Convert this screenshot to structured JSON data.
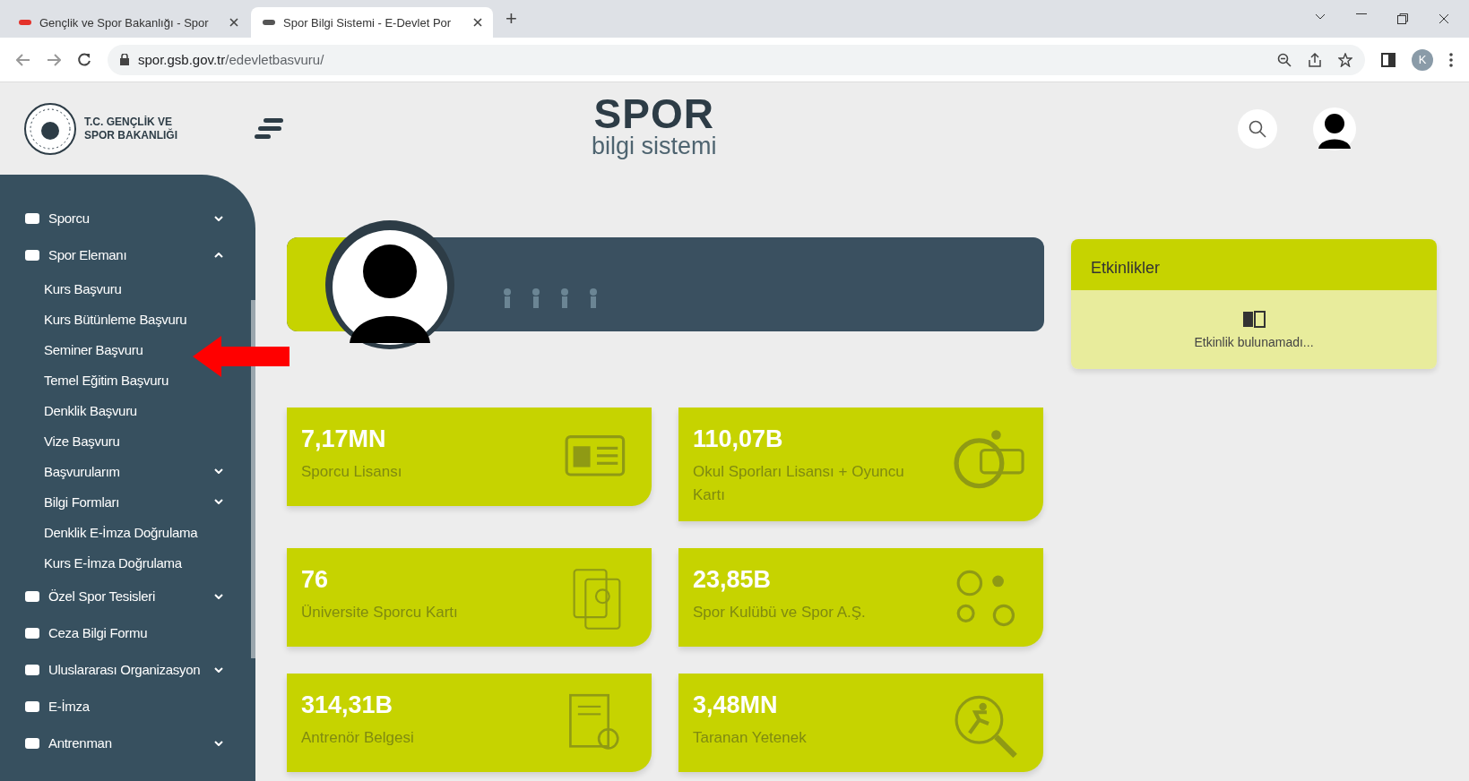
{
  "browser": {
    "tabs": [
      {
        "title": "Gençlik ve Spor Bakanlığı - Spor",
        "selected": false
      },
      {
        "title": "Spor Bilgi Sistemi - E-Devlet Por",
        "selected": true
      }
    ],
    "new_tab": "+",
    "address": {
      "host": "spor.gsb.gov.tr",
      "path": "/edevletbasvuru/"
    },
    "profile_initial": "K"
  },
  "header": {
    "ministry": "T.C. GENÇLİK VE SPOR BAKANLIĞI",
    "logo_title": "SPOR",
    "logo_subtitle": "bilgi sistemi"
  },
  "sidebar": {
    "items": [
      {
        "label": "Sporcu",
        "kind": "group",
        "expanded": false
      },
      {
        "label": "Spor Elemanı",
        "kind": "group",
        "expanded": true,
        "children": [
          {
            "label": "Kurs Başvuru",
            "kind": "link"
          },
          {
            "label": "Kurs Bütünleme Başvuru",
            "kind": "link"
          },
          {
            "label": "Seminer Başvuru",
            "kind": "link"
          },
          {
            "label": "Temel Eğitim Başvuru",
            "kind": "link"
          },
          {
            "label": "Denklik Başvuru",
            "kind": "link"
          },
          {
            "label": "Vize Başvuru",
            "kind": "link"
          },
          {
            "label": "Başvurularım",
            "kind": "group",
            "expanded": false
          },
          {
            "label": "Bilgi Formları",
            "kind": "group",
            "expanded": false
          },
          {
            "label": "Denklik E-İmza Doğrulama",
            "kind": "link"
          },
          {
            "label": "Kurs E-İmza Doğrulama",
            "kind": "link"
          }
        ]
      },
      {
        "label": "Özel Spor Tesisleri",
        "kind": "group",
        "expanded": false
      },
      {
        "label": "Ceza Bilgi Formu",
        "kind": "link"
      },
      {
        "label": "Uluslararası Organizasyon",
        "kind": "group",
        "expanded": false
      },
      {
        "label": "E-İmza",
        "kind": "link"
      },
      {
        "label": "Antrenman",
        "kind": "group",
        "expanded": false
      }
    ]
  },
  "stats": [
    {
      "value": "7,17MN",
      "label": "Sporcu Lisansı",
      "kind": "license"
    },
    {
      "value": "110,07B",
      "label": "Okul Sporları Lisansı + Oyuncu Kartı",
      "kind": "school"
    },
    {
      "value": "76",
      "label": "Üniversite Sporcu Kartı",
      "kind": "university"
    },
    {
      "value": "23,85B",
      "label": "Spor Kulübü ve Spor A.Ş.",
      "kind": "club"
    },
    {
      "value": "314,31B",
      "label": "Antrenör Belgesi",
      "kind": "certificate"
    },
    {
      "value": "3,48MN",
      "label": "Taranan Yetenek",
      "kind": "talent"
    }
  ],
  "events": {
    "title": "Etkinlikler",
    "empty_text": "Etkinlik bulunamadı..."
  }
}
